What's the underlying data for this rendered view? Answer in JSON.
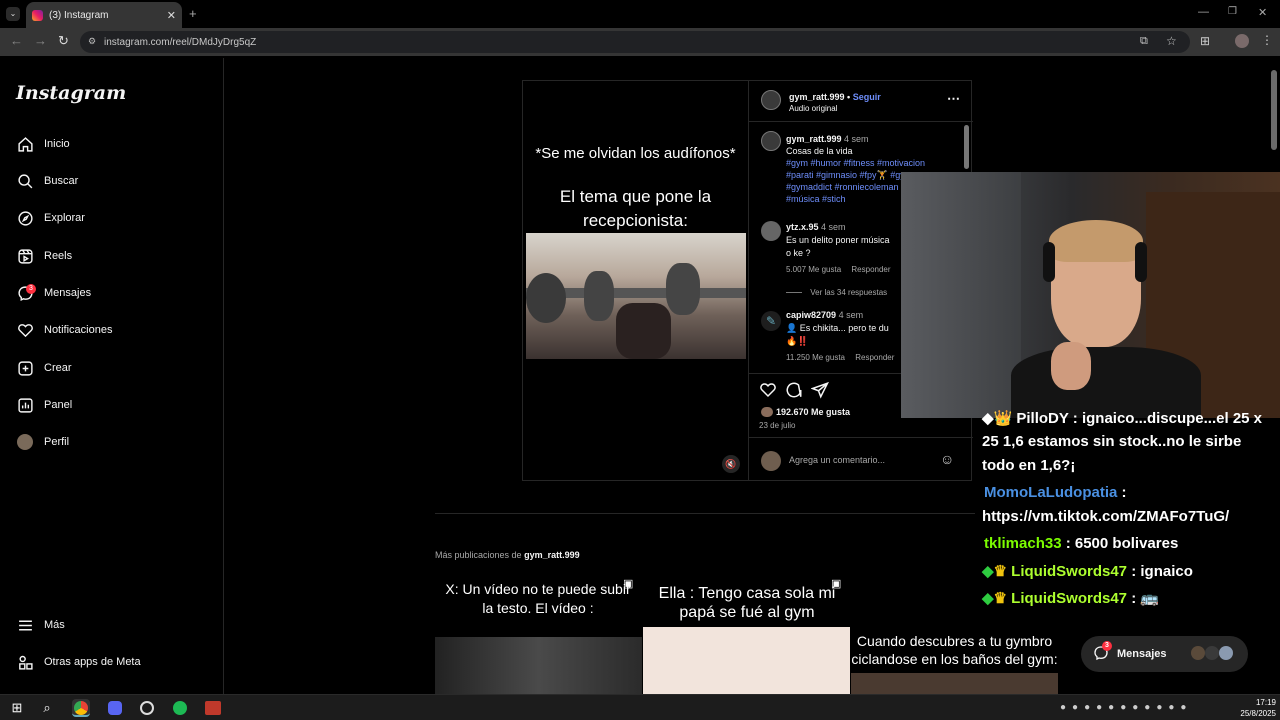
{
  "browser": {
    "tab_title": "(3) Instagram",
    "url": "instagram.com/reel/DMdJyDrg5qZ"
  },
  "sidebar": {
    "logo": "Instagram",
    "items": [
      {
        "label": "Inicio",
        "icon": "home-icon"
      },
      {
        "label": "Buscar",
        "icon": "search-icon"
      },
      {
        "label": "Explorar",
        "icon": "compass-icon"
      },
      {
        "label": "Reels",
        "icon": "reels-icon"
      },
      {
        "label": "Mensajes",
        "icon": "messenger-icon",
        "badge": "3"
      },
      {
        "label": "Notificaciones",
        "icon": "heart-icon"
      },
      {
        "label": "Crear",
        "icon": "plus-icon"
      },
      {
        "label": "Panel",
        "icon": "chart-icon"
      },
      {
        "label": "Perfil",
        "icon": "avatar"
      }
    ],
    "bottom": [
      {
        "label": "Más",
        "icon": "menu-icon"
      },
      {
        "label": "Otras apps de Meta",
        "icon": "apps-icon"
      }
    ]
  },
  "post": {
    "media_caption_1": "*Se me olvidan los audífonos*",
    "media_caption_2": "El tema que pone la recepcionista:",
    "author": "gym_ratt.999",
    "follow": "Seguir",
    "audio": "Audio original",
    "caption_author": "gym_ratt.999",
    "caption_time": "4 sem",
    "caption_text": "Cosas de la vida",
    "hashtags_1": "#gym #humor #fitness #motivacion",
    "hashtags_2": "#parati #gimnasio #fpy🏋 #gymrat",
    "hashtags_3": "#gymaddict #ronniecoleman",
    "hashtags_4": "#música #stich",
    "comments": [
      {
        "user": "ytz.x.95",
        "time": "4 sem",
        "text_1": "Es un delito poner música",
        "text_2": "o ke ?",
        "likes": "5.007 Me gusta",
        "reply": "Responder",
        "replies": "Ver las 34 respuestas"
      },
      {
        "user": "capiw82709",
        "time": "4 sem",
        "text_1": "👤 Es chikita... pero te du",
        "text_2": "🔥‼️",
        "likes": "11.250 Me gusta",
        "reply": "Responder"
      }
    ],
    "likes": "192.670 Me gusta",
    "date": "23 de julio",
    "comment_placeholder": "Agrega un comentario..."
  },
  "more": {
    "label_prefix": "Más publicaciones de",
    "label_user": "gym_ratt.999",
    "tile1": "X: Un vídeo no te puede subir la testo. El vídeo :",
    "tile2": "Ella : Tengo casa sola mi papá se fué al gym",
    "tile3": "Cuando descubres a tu gymbro ciclandose en los baños del gym:"
  },
  "chat": {
    "line0": "◆👑 PilloDY : ignaico...discupe...el 25 x",
    "line0b": "25 1,6 estamos sin stock..no le sirbe",
    "line0c": "todo en 1,6?¡",
    "line1_user": "MomoLaLudopatia",
    "line1_sep": " :",
    "line1_text": "https://vm.tiktok.com/ZMAFo7TuG/",
    "line2_user": "tklimach33",
    "line2_text": " : 6500 bolivares",
    "line3_user": "LiquidSwords47",
    "line3_text": " : ignaico",
    "line4_user": "LiquidSwords47",
    "line4_text": " : 🚌",
    "user1_color": "#4a90e2",
    "user2_color": "#7cfc00",
    "user3_color": "#adff2f"
  },
  "messages_bar": {
    "label": "Mensajes",
    "badge": "3"
  },
  "taskbar": {
    "time": "17:19",
    "date": "25/8/2025"
  }
}
